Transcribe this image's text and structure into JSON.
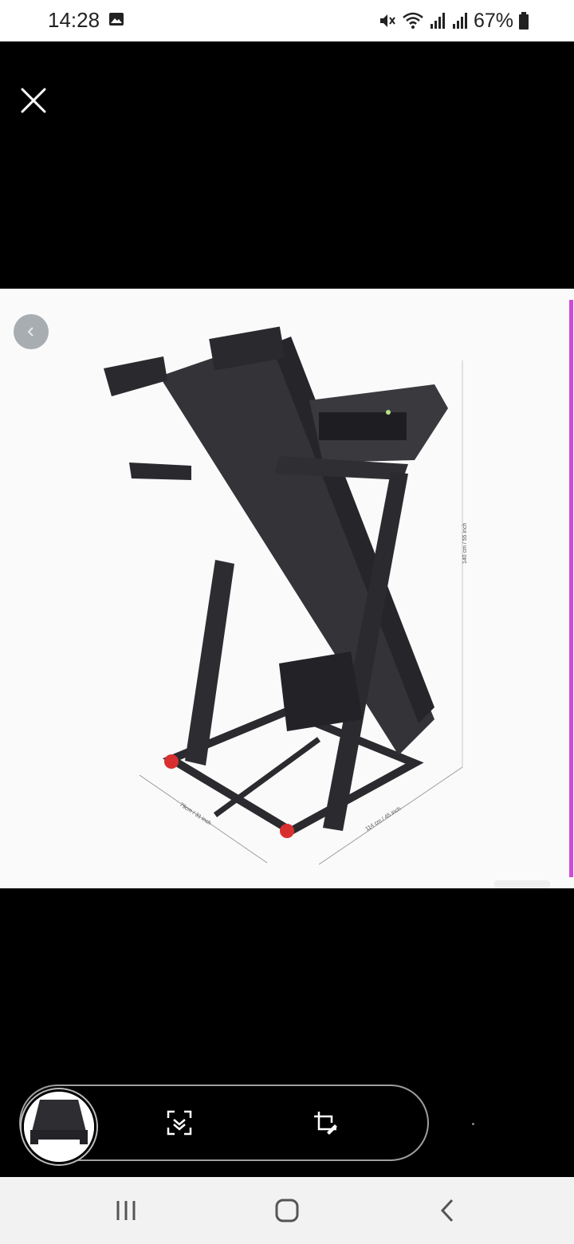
{
  "status_bar": {
    "time": "14:28",
    "battery": "67%",
    "icons": [
      "gallery-icon",
      "mute-icon",
      "wifi-icon",
      "signal-icon",
      "signal-icon",
      "battery-icon"
    ]
  },
  "viewer": {
    "close_icon": "close-icon",
    "back_icon": "chevron-left-icon",
    "image_labels": {
      "height": "140 cm / 55 inch",
      "width": "79cm / 31 inch",
      "length": "114 cm / 45 inch"
    },
    "accent_color": "#d04ad8"
  },
  "lens_bar": {
    "thumbnail": "treadmill-thumbnail",
    "actions": [
      "scan-text-icon",
      "crop-edit-icon"
    ]
  },
  "nav_bar": {
    "buttons": [
      "recent-apps-icon",
      "home-icon",
      "back-icon"
    ]
  }
}
